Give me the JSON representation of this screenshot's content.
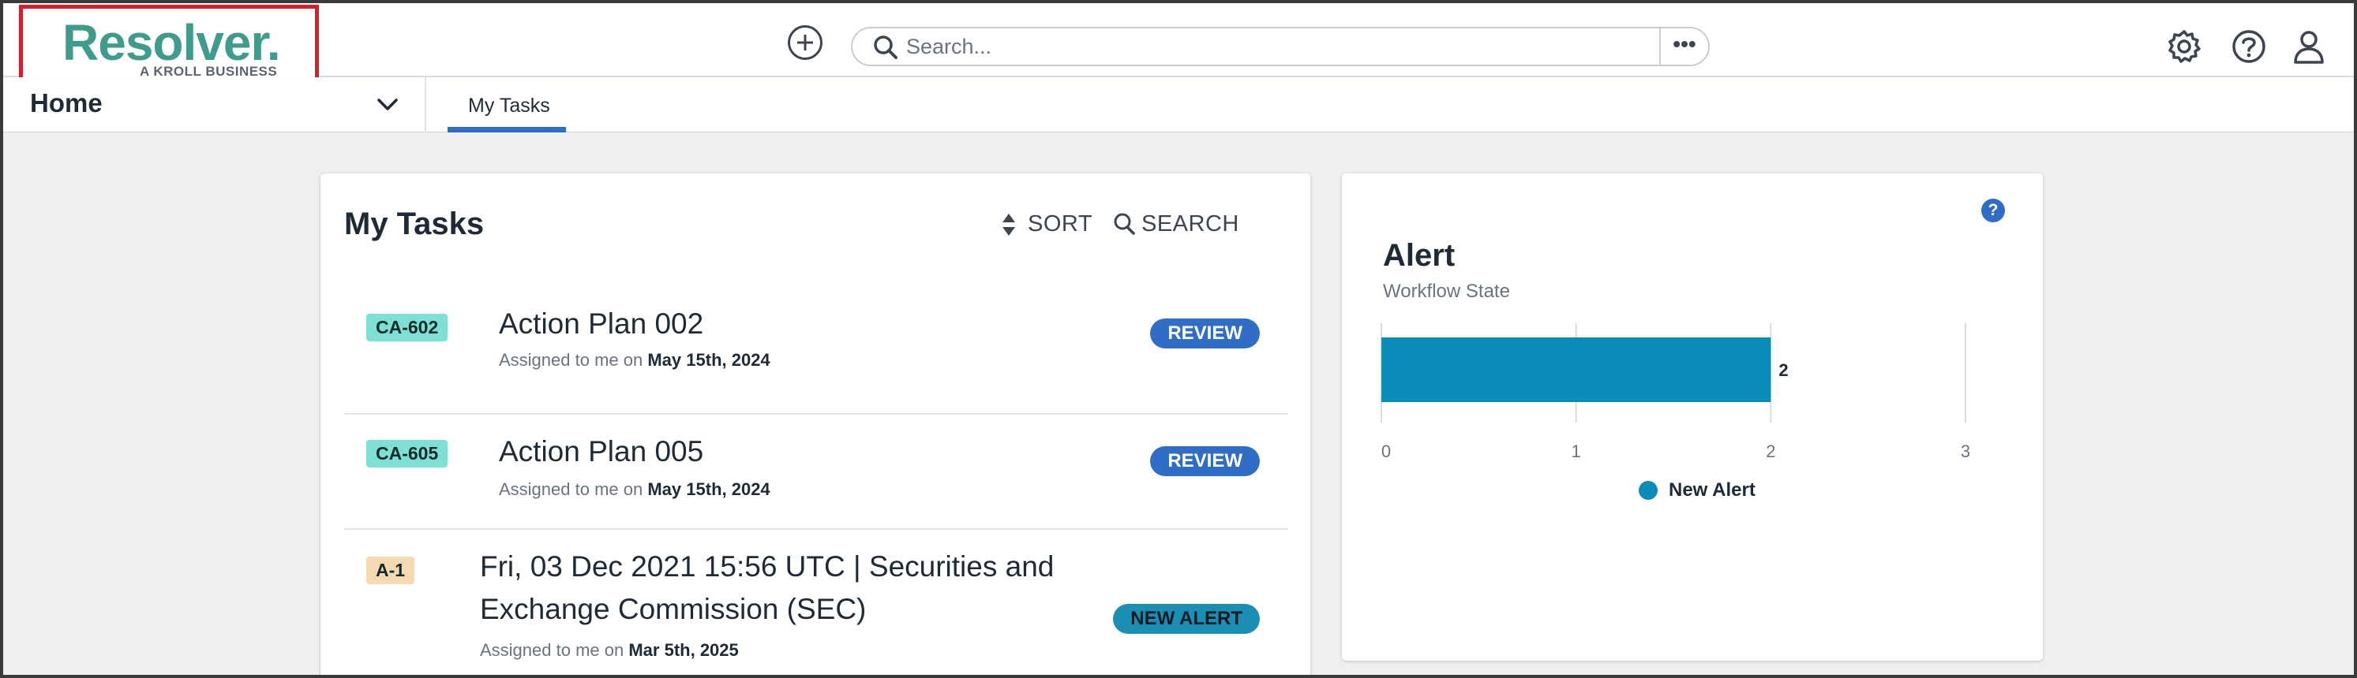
{
  "logo": {
    "name": "Resolver.",
    "tagline": "A KROLL BUSINESS"
  },
  "search": {
    "placeholder": "Search...",
    "more_label": "•••"
  },
  "nav": {
    "home_label": "Home",
    "tabs": [
      {
        "label": "My Tasks",
        "active": true
      }
    ]
  },
  "tasks": {
    "title": "My Tasks",
    "sort_label": "SORT",
    "search_label": "SEARCH",
    "items": [
      {
        "id": "CA-602",
        "id_color": "#7ee0d4",
        "title": "Action Plan 002",
        "assigned_prefix": "Assigned to me on",
        "assigned_date": "May 15th, 2024",
        "status": "REVIEW",
        "status_color": "#2f6dc6"
      },
      {
        "id": "CA-605",
        "id_color": "#7ee0d4",
        "title": "Action Plan 005",
        "assigned_prefix": "Assigned to me on",
        "assigned_date": "May 15th, 2024",
        "status": "REVIEW",
        "status_color": "#2f6dc6"
      },
      {
        "id": "A-1",
        "id_color": "#f5d9b0",
        "title": "Fri, 03 Dec 2021 15:56 UTC | Securities and Exchange Commission (SEC)",
        "assigned_prefix": "Assigned to me on",
        "assigned_date": "Mar 5th, 2025",
        "status": "NEW ALERT",
        "status_color": "#1b8fb3"
      }
    ]
  },
  "alert_card": {
    "help": "?",
    "title": "Alert",
    "subtitle": "Workflow State"
  },
  "chart_data": {
    "type": "bar",
    "orientation": "horizontal",
    "title": "Alert",
    "subtitle": "Workflow State",
    "categories": [
      "New Alert"
    ],
    "series": [
      {
        "name": "New Alert",
        "values": [
          2
        ],
        "color": "#0b8bb8"
      }
    ],
    "xlim": [
      0,
      3
    ],
    "xticks": [
      "0",
      "1",
      "2",
      "3"
    ],
    "data_labels": [
      "2"
    ],
    "grid": true,
    "legend": "bottom"
  },
  "colors": {
    "accent": "#2f6dc6",
    "logo_green": "#3f9c8c",
    "logo_border": "#d3202a",
    "background": "#efefef"
  },
  "icons": {
    "add": "plus-circle-icon",
    "search": "search-icon",
    "settings": "gear-icon",
    "help": "question-circle-icon",
    "user": "user-icon",
    "chevron": "chevron-down-icon",
    "sort": "sort-icon"
  }
}
